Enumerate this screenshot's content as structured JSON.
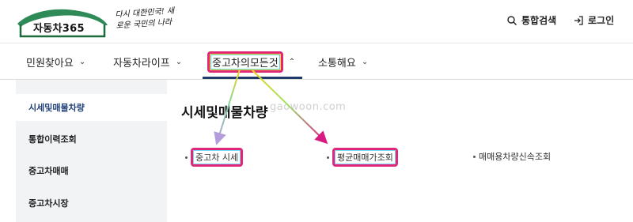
{
  "header": {
    "logo_text": "자동차365",
    "slogan": "다시 대한민국! 새로운 국민의 나라",
    "search_label": "통합검색",
    "login_label": "로그인"
  },
  "gnb": {
    "items": [
      {
        "label": "민원찾아요",
        "icon": "chevron-down-icon"
      },
      {
        "label": "자동차라이프",
        "icon": "chevron-down-icon"
      },
      {
        "label": "중고차의모든것",
        "icon": "chevron-up-icon",
        "active": true
      },
      {
        "label": "소통해요",
        "icon": "chevron-down-icon"
      }
    ]
  },
  "sidebar": {
    "items": [
      {
        "label": "시세및매물차량",
        "active": true
      },
      {
        "label": "통합이력조회"
      },
      {
        "label": "중고차매매"
      },
      {
        "label": "중고차시장"
      }
    ]
  },
  "content": {
    "title": "시세및매물차량",
    "watermark": "gaowoon.com",
    "links": [
      {
        "label": "중고차 시세"
      },
      {
        "label": "평균매매가조회"
      },
      {
        "label": "매매용차량신속조회"
      }
    ]
  },
  "colors": {
    "accent": "#1d3a6b",
    "highlight": "#e0287a",
    "sidebar_bg": "#f2f3f5"
  }
}
